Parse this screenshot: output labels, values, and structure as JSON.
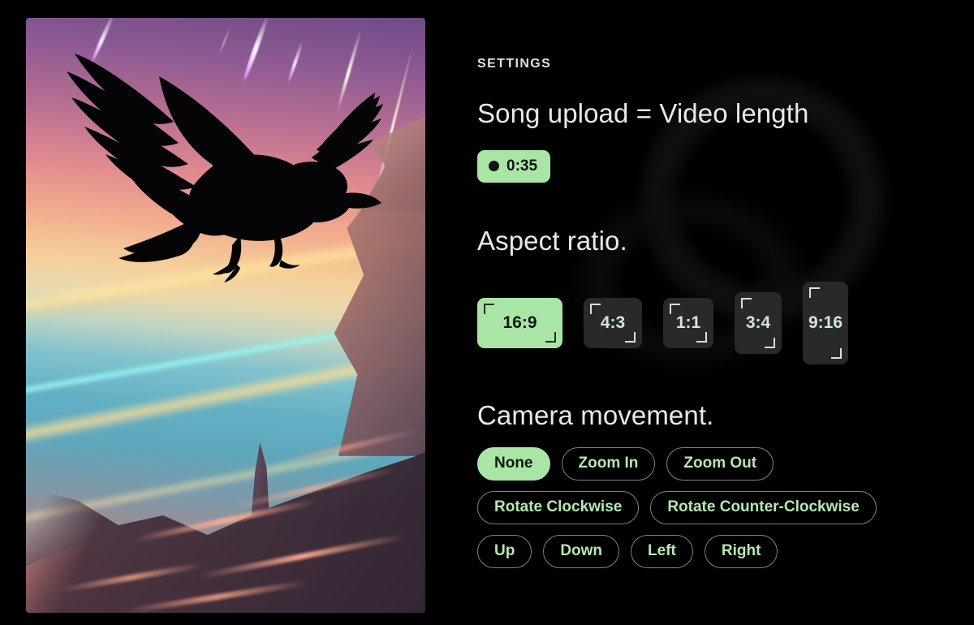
{
  "preview": {
    "alt_description": "Silhouette of an eagle in flight over a pastel sunset alien landscape with meteors"
  },
  "settings": {
    "eyebrow": "SETTINGS",
    "duration_section": {
      "title": "Song upload = Video length",
      "chip": {
        "icon": "record-dot-icon",
        "value": "0:35"
      }
    },
    "aspect_section": {
      "title": "Aspect ratio.",
      "selected": "16:9",
      "options": [
        {
          "label": "16:9",
          "selected": true
        },
        {
          "label": "4:3",
          "selected": false
        },
        {
          "label": "1:1",
          "selected": false
        },
        {
          "label": "3:4",
          "selected": false
        },
        {
          "label": "9:16",
          "selected": false
        }
      ]
    },
    "camera_section": {
      "title": "Camera movement.",
      "selected": "None",
      "rows": [
        [
          {
            "label": "None",
            "selected": true
          },
          {
            "label": "Zoom In",
            "selected": false
          },
          {
            "label": "Zoom Out",
            "selected": false
          }
        ],
        [
          {
            "label": "Rotate Clockwise",
            "selected": false
          },
          {
            "label": "Rotate Counter-Clockwise",
            "selected": false
          }
        ],
        [
          {
            "label": "Up",
            "selected": false
          },
          {
            "label": "Down",
            "selected": false
          },
          {
            "label": "Left",
            "selected": false
          },
          {
            "label": "Right",
            "selected": false
          }
        ]
      ]
    }
  },
  "colors": {
    "background": "#000000",
    "accent_green": "#a9e6a6",
    "heading_text": "#e2ece5",
    "pill_text": "#b6e7b4",
    "pill_border": "#6e8c74",
    "chip_dark": "#292929",
    "on_accent_text": "#0e1a0e"
  }
}
